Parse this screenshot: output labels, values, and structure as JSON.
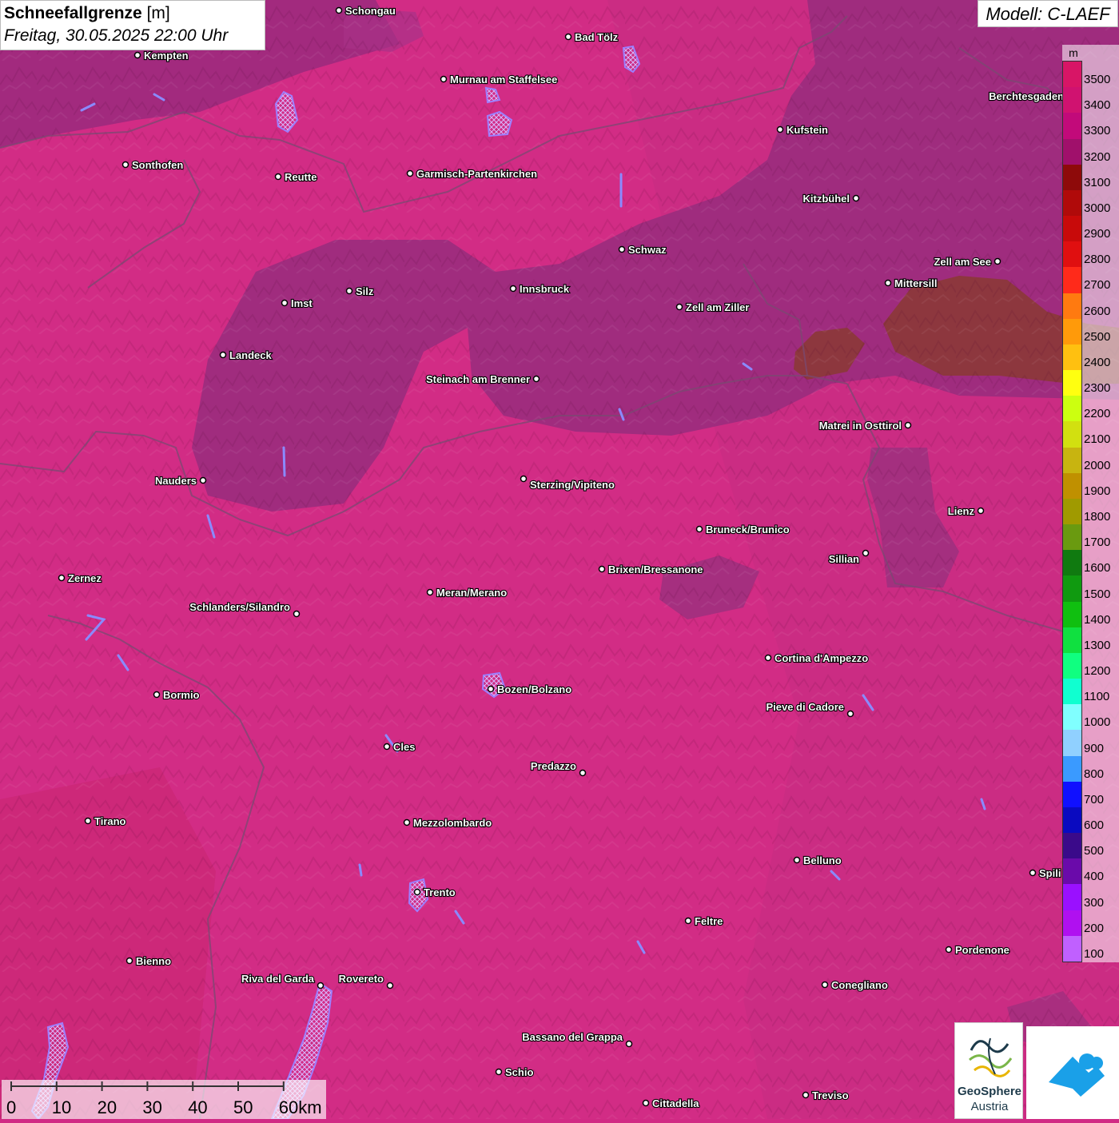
{
  "title": {
    "main": "Schneefallgrenze",
    "unit": "[m]",
    "datetime": "Freitag, 30.05.2025 22:00 Uhr"
  },
  "model": "Modell: C-LAEF",
  "legend": {
    "unit": "m",
    "levels": [
      {
        "label": "3500",
        "color": "#d81566"
      },
      {
        "label": "3400",
        "color": "#d01270"
      },
      {
        "label": "3300",
        "color": "#c20a7a"
      },
      {
        "label": "3200",
        "color": "#a0106b"
      },
      {
        "label": "3100",
        "color": "#8e0a0a"
      },
      {
        "label": "3000",
        "color": "#b00a0a"
      },
      {
        "label": "2900",
        "color": "#c80a0a"
      },
      {
        "label": "2800",
        "color": "#e00f10"
      },
      {
        "label": "2700",
        "color": "#ff2a1a"
      },
      {
        "label": "2600",
        "color": "#ff7a10"
      },
      {
        "label": "2500",
        "color": "#ff9a0a"
      },
      {
        "label": "2400",
        "color": "#ffc010"
      },
      {
        "label": "2300",
        "color": "#ffff10"
      },
      {
        "label": "2200",
        "color": "#ccff10"
      },
      {
        "label": "2100",
        "color": "#d2e010"
      },
      {
        "label": "2000",
        "color": "#c8b410"
      },
      {
        "label": "1900",
        "color": "#c09000"
      },
      {
        "label": "1800",
        "color": "#a09a00"
      },
      {
        "label": "1700",
        "color": "#6a9a10"
      },
      {
        "label": "1600",
        "color": "#107a10"
      },
      {
        "label": "1500",
        "color": "#109a10"
      },
      {
        "label": "1400",
        "color": "#10bf10"
      },
      {
        "label": "1300",
        "color": "#10e040"
      },
      {
        "label": "1200",
        "color": "#10ff80"
      },
      {
        "label": "1100",
        "color": "#10ffd0"
      },
      {
        "label": "1000",
        "color": "#80ffff"
      },
      {
        "label": "900",
        "color": "#90d0ff"
      },
      {
        "label": "800",
        "color": "#3a9aff"
      },
      {
        "label": "700",
        "color": "#1010ff"
      },
      {
        "label": "600",
        "color": "#0a0ac0"
      },
      {
        "label": "500",
        "color": "#3a0a8a"
      },
      {
        "label": "400",
        "color": "#6a0aaa"
      },
      {
        "label": "300",
        "color": "#9a10ff"
      },
      {
        "label": "200",
        "color": "#b010f0"
      },
      {
        "label": "100",
        "color": "#c060ff"
      }
    ]
  },
  "cities": [
    {
      "name": "Schongau"
    },
    {
      "name": "Bad Tölz"
    },
    {
      "name": "Kempten"
    },
    {
      "name": "Murnau am Staffelsee"
    },
    {
      "name": "Berchtesgaden"
    },
    {
      "name": "Kufstein"
    },
    {
      "name": "Sonthofen"
    },
    {
      "name": "Reutte"
    },
    {
      "name": "Garmisch-Partenkirchen"
    },
    {
      "name": "Kitzbühel"
    },
    {
      "name": "Schwaz"
    },
    {
      "name": "Zell am See"
    },
    {
      "name": "Mittersill"
    },
    {
      "name": "Innsbruck"
    },
    {
      "name": "Silz"
    },
    {
      "name": "Imst"
    },
    {
      "name": "Zell am Ziller"
    },
    {
      "name": "Landeck"
    },
    {
      "name": "Steinach am Brenner"
    },
    {
      "name": "Matrei in Osttirol"
    },
    {
      "name": "Nauders"
    },
    {
      "name": "Sterzing/Vipiteno"
    },
    {
      "name": "Lienz"
    },
    {
      "name": "Bruneck/Brunico"
    },
    {
      "name": "Sillian"
    },
    {
      "name": "Brixen/Bressanone"
    },
    {
      "name": "Zernez"
    },
    {
      "name": "Meran/Merano"
    },
    {
      "name": "Schlanders/Silandro"
    },
    {
      "name": "Cortina d'Ampezzo"
    },
    {
      "name": "Bozen/Bolzano"
    },
    {
      "name": "Bormio"
    },
    {
      "name": "Pieve di Cadore"
    },
    {
      "name": "Cles"
    },
    {
      "name": "Predazzo"
    },
    {
      "name": "Tirano"
    },
    {
      "name": "Mezzolombardo"
    },
    {
      "name": "Belluno"
    },
    {
      "name": "Spili"
    },
    {
      "name": "Trento"
    },
    {
      "name": "Feltre"
    },
    {
      "name": "Pordenone"
    },
    {
      "name": "Bienno"
    },
    {
      "name": "Riva del Garda"
    },
    {
      "name": "Rovereto"
    },
    {
      "name": "Conegliano"
    },
    {
      "name": "Bassano del Grappa"
    },
    {
      "name": "Schio"
    },
    {
      "name": "Treviso"
    },
    {
      "name": "Cittadella"
    }
  ],
  "scale_bar": {
    "labels": [
      "0",
      "10",
      "20",
      "30",
      "40",
      "50",
      "60km"
    ]
  },
  "logos": {
    "geosphere_name": "GeoSphere",
    "geosphere_sub": "Austria"
  }
}
